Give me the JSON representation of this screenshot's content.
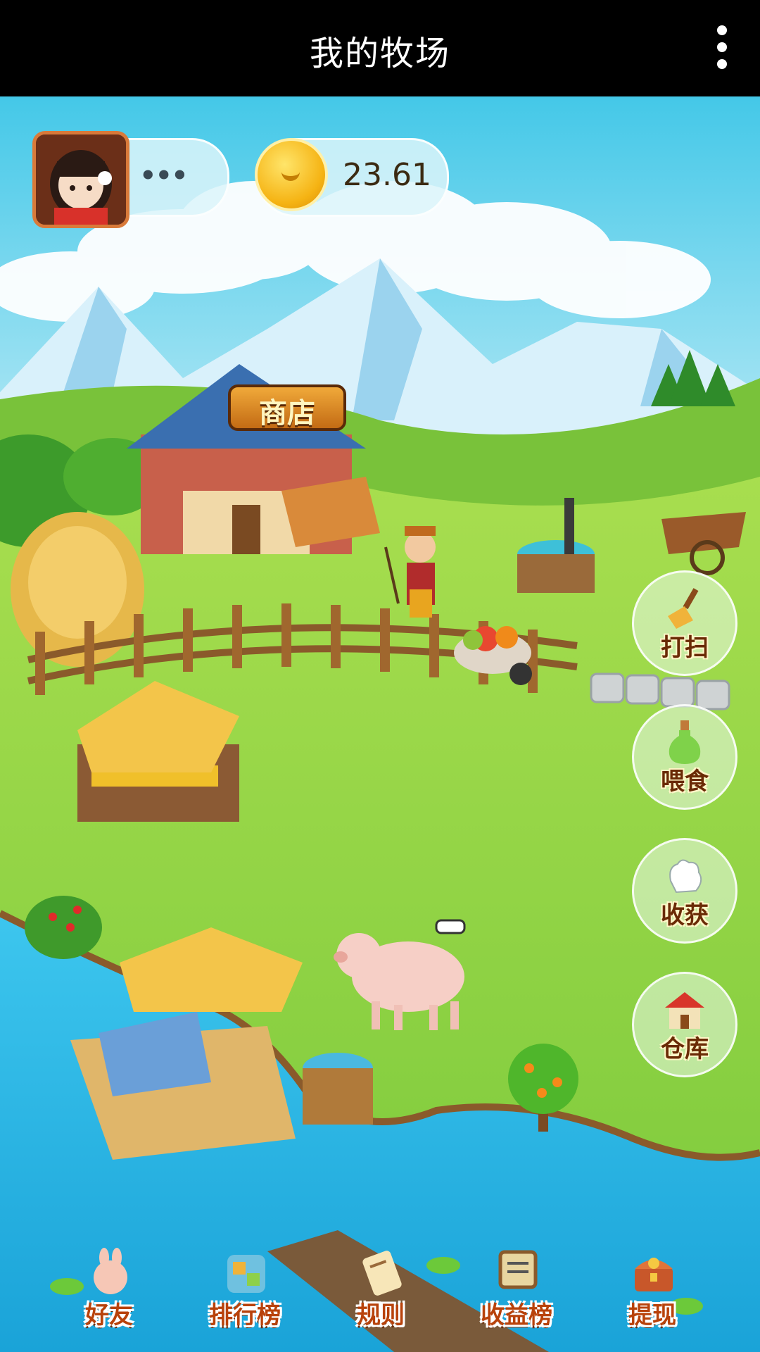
{
  "header": {
    "title": "我的牧场",
    "menu_icon": "more-vertical-icon"
  },
  "user": {
    "name": "ꔷꔷꔷ",
    "avatar_icon": "girl-avatar-icon"
  },
  "balance": {
    "amount": "23.61",
    "icon": "gold-coin-icon"
  },
  "scene": {
    "shop_label": "商店"
  },
  "actions": [
    {
      "label": "打扫",
      "icon": "broom-icon"
    },
    {
      "label": "喂食",
      "icon": "potion-bottle-icon"
    },
    {
      "label": "收获",
      "icon": "glove-hand-icon"
    },
    {
      "label": "仓库",
      "icon": "barn-icon"
    }
  ],
  "nav": [
    {
      "label": "好友",
      "icon": "bunny-friends-icon"
    },
    {
      "label": "排行榜",
      "icon": "leaderboard-icon"
    },
    {
      "label": "规则",
      "icon": "scroll-rules-icon"
    },
    {
      "label": "收益榜",
      "icon": "earnings-board-icon"
    },
    {
      "label": "提现",
      "icon": "treasure-chest-icon"
    }
  ],
  "colors": {
    "sky": "#5fd0ec",
    "grass": "#8fd44a",
    "water": "#2bb6e0",
    "topbar": "#000000"
  }
}
